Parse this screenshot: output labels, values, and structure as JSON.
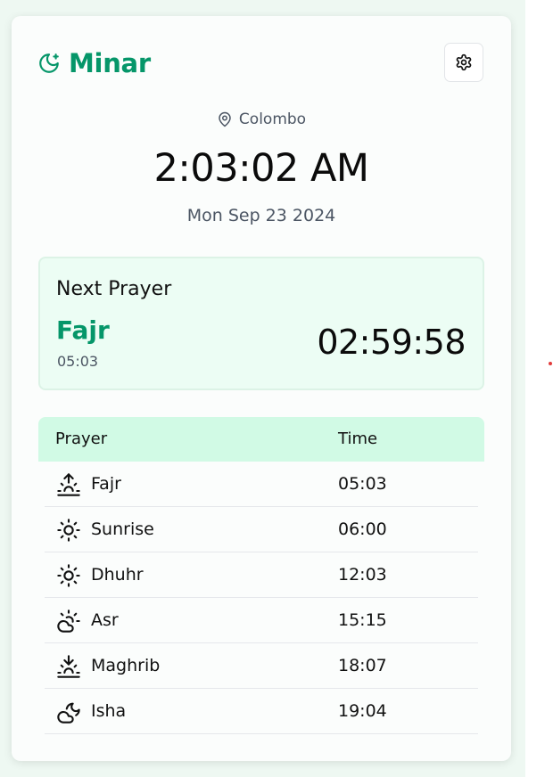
{
  "app": {
    "name": "Minar",
    "brand_color": "#059669",
    "logo_icon": "moon-star-icon",
    "settings_icon": "gear-icon"
  },
  "location": {
    "icon": "map-pin-icon",
    "city": "Colombo"
  },
  "clock": {
    "time": "2:03:02 AM",
    "date": "Mon Sep 23 2024"
  },
  "next_prayer": {
    "heading": "Next Prayer",
    "name": "Fajr",
    "time": "05:03",
    "countdown": "02:59:58"
  },
  "table": {
    "header_prayer": "Prayer",
    "header_time": "Time",
    "header_bg": "#d1fae5",
    "rows": [
      {
        "name": "Fajr",
        "time": "05:03",
        "icon": "sunrise-icon"
      },
      {
        "name": "Sunrise",
        "time": "06:00",
        "icon": "sun-icon"
      },
      {
        "name": "Dhuhr",
        "time": "12:03",
        "icon": "sun-icon"
      },
      {
        "name": "Asr",
        "time": "15:15",
        "icon": "cloud-sun-icon"
      },
      {
        "name": "Maghrib",
        "time": "18:07",
        "icon": "sunset-icon"
      },
      {
        "name": "Isha",
        "time": "19:04",
        "icon": "cloud-moon-icon"
      }
    ]
  }
}
